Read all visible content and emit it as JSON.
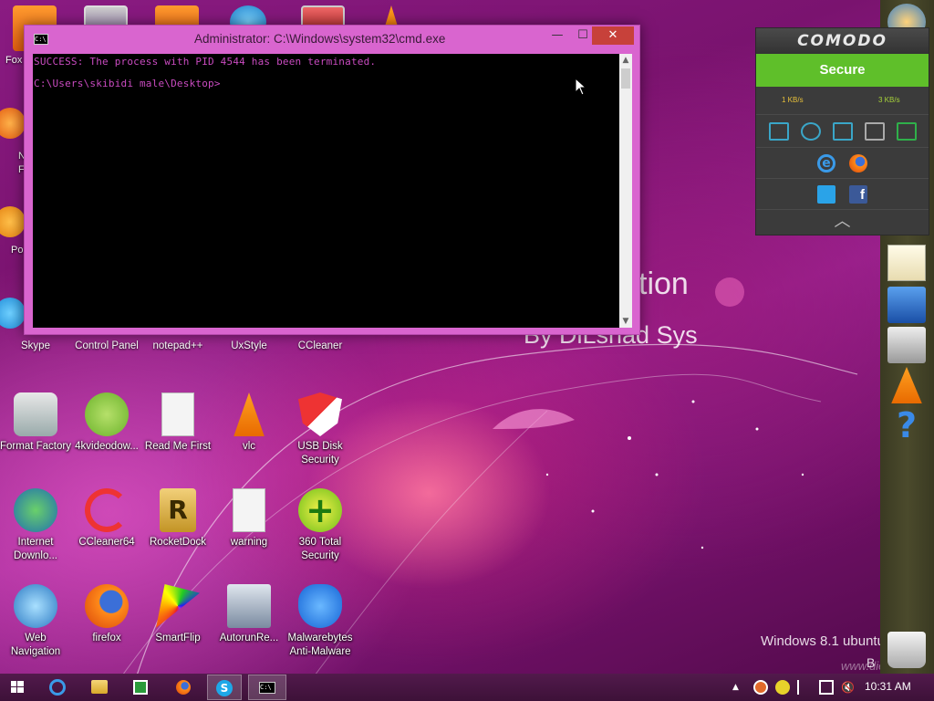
{
  "cmd": {
    "title": "Administrator: C:\\Windows\\system32\\cmd.exe",
    "line1": "SUCCESS: The process with PID 4544 has been terminated.",
    "line2": "C:\\Users\\skibidi male\\Desktop>",
    "min_glyph": "—",
    "max_glyph": "☐",
    "close_glyph": "✕"
  },
  "comodo": {
    "brand": "COMODO",
    "status": "Secure",
    "speed_down": "1 KB/s",
    "speed_up": "3 KB/s",
    "collapse_glyph": "︿"
  },
  "wallpaper": {
    "title_partial": "tion",
    "subtitle": "By DiLshad Sys",
    "os_text": "Windows 8.1 ubuntu",
    "os_by": "B",
    "url_partial": "www.die"
  },
  "partial_left_labels": [
    "Fox",
    "N",
    "F",
    "Po"
  ],
  "row_labels": [
    "Skype",
    "Control Panel",
    "notepad++",
    "UxStyle",
    "CCleaner"
  ],
  "desktop_icons": [
    {
      "label": "Format Factory",
      "icon": "format-factory-icon"
    },
    {
      "label": "4kvideodow...",
      "icon": "download-cloud-icon"
    },
    {
      "label": "Read Me First",
      "icon": "document-pen-icon"
    },
    {
      "label": "vlc",
      "icon": "vlc-cone-icon"
    },
    {
      "label": "USB Disk Security",
      "icon": "shield-icon"
    },
    {
      "label": "Internet Downlo...",
      "icon": "globe-arrow-icon"
    },
    {
      "label": "CCleaner64",
      "icon": "ccleaner-icon"
    },
    {
      "label": "RocketDock",
      "icon": "rocketdock-icon"
    },
    {
      "label": "warning",
      "icon": "document-pen-icon"
    },
    {
      "label": "360 Total Security",
      "icon": "plus-circle-icon"
    },
    {
      "label": "Web Navigation",
      "icon": "globe-icon"
    },
    {
      "label": "firefox",
      "icon": "firefox-icon"
    },
    {
      "label": "SmartFlip",
      "icon": "color-fan-icon"
    },
    {
      "label": "AutorunRe...",
      "icon": "computer-scan-icon"
    },
    {
      "label": "Malwarebytes Anti-Malware",
      "icon": "malwarebytes-icon"
    }
  ],
  "taskbar": {
    "clock": "10:31 AM",
    "tray_up_glyph": "▲"
  },
  "colors": {
    "secure_green": "#5fbf2a",
    "cmd_text": "#c94bc0",
    "close_red": "#c7413a"
  }
}
